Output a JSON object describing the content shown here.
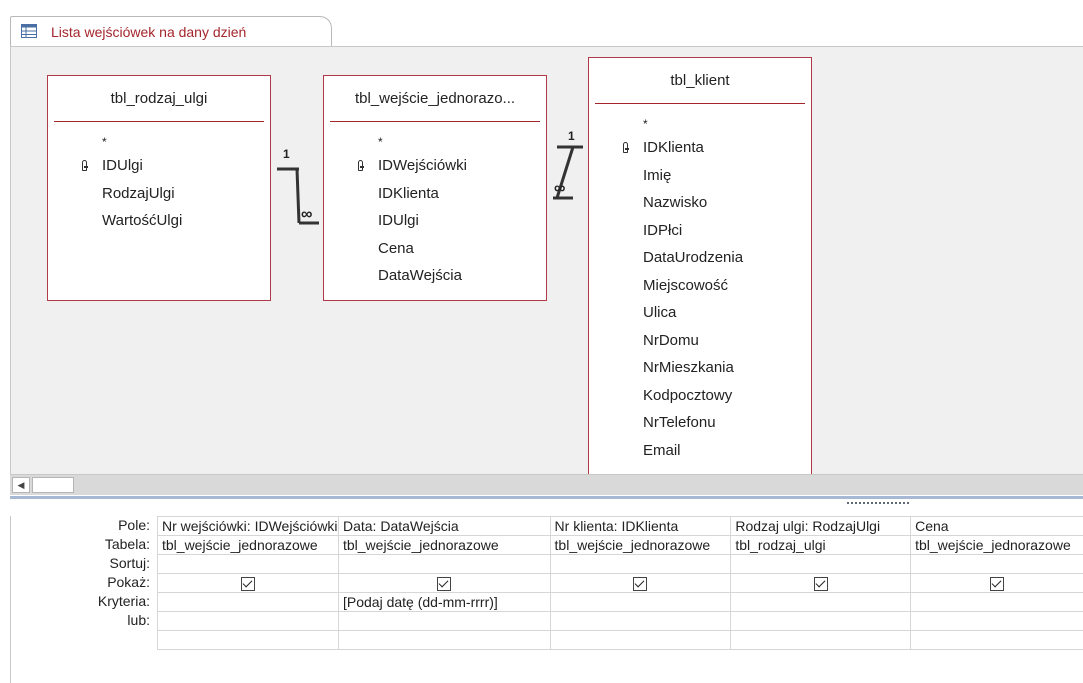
{
  "tab": {
    "title": "Lista wejściówek na dany dzień"
  },
  "tables": [
    {
      "name": "tbl_rodzaj_ulgi",
      "fields": [
        "*",
        "IDUlgi",
        "RodzajUlgi",
        "WartośćUlgi"
      ],
      "key_field": "IDUlgi"
    },
    {
      "name": "tbl_wejście_jednorazo...",
      "fields": [
        "*",
        "IDWejściówki",
        "IDKlienta",
        "IDUlgi",
        "Cena",
        "DataWejścia"
      ],
      "key_field": "IDWejściówki"
    },
    {
      "name": "tbl_klient",
      "fields": [
        "*",
        "IDKlienta",
        "Imię",
        "Nazwisko",
        "IDPłci",
        "DataUrodzenia",
        "Miejscowość",
        "Ulica",
        "NrDomu",
        "NrMieszkania",
        "Kodpocztowy",
        "NrTelefonu",
        "Email"
      ],
      "key_field": "IDKlienta"
    }
  ],
  "relationships": [
    {
      "one_label": "1",
      "many_label": "∞"
    },
    {
      "one_label": "1",
      "many_label": "∞"
    }
  ],
  "grid": {
    "row_labels": [
      "Pole:",
      "Tabela:",
      "Sortuj:",
      "Pokaż:",
      "Kryteria:",
      "lub:"
    ],
    "columns": [
      {
        "pole": "Nr wejściówki: IDWejściówki",
        "tabela": "tbl_wejście_jednorazowe",
        "sortuj": "",
        "pokaz": true,
        "kryteria": "",
        "lub": ""
      },
      {
        "pole": "Data: DataWejścia",
        "tabela": "tbl_wejście_jednorazowe",
        "sortuj": "",
        "pokaz": true,
        "kryteria": "[Podaj datę (dd-mm-rrrr)]",
        "lub": ""
      },
      {
        "pole": "Nr klienta: IDKlienta",
        "tabela": "tbl_wejście_jednorazowe",
        "sortuj": "",
        "pokaz": true,
        "kryteria": "",
        "lub": ""
      },
      {
        "pole": "Rodzaj ulgi: RodzajUlgi",
        "tabela": "tbl_rodzaj_ulgi",
        "sortuj": "",
        "pokaz": true,
        "kryteria": "",
        "lub": ""
      },
      {
        "pole": "Cena",
        "tabela": "tbl_wejście_jednorazowe",
        "sortuj": "",
        "pokaz": true,
        "kryteria": "",
        "lub": ""
      }
    ]
  },
  "icons": {
    "tab": "query-design-icon",
    "key": "primary-key-icon",
    "scroll_left": "scroll-left-arrow-icon"
  },
  "colors": {
    "accent": "#a4262c",
    "table_border": "#b0394a",
    "designer_bg": "#f0f0f0",
    "splitter": "#a6b8d4"
  }
}
